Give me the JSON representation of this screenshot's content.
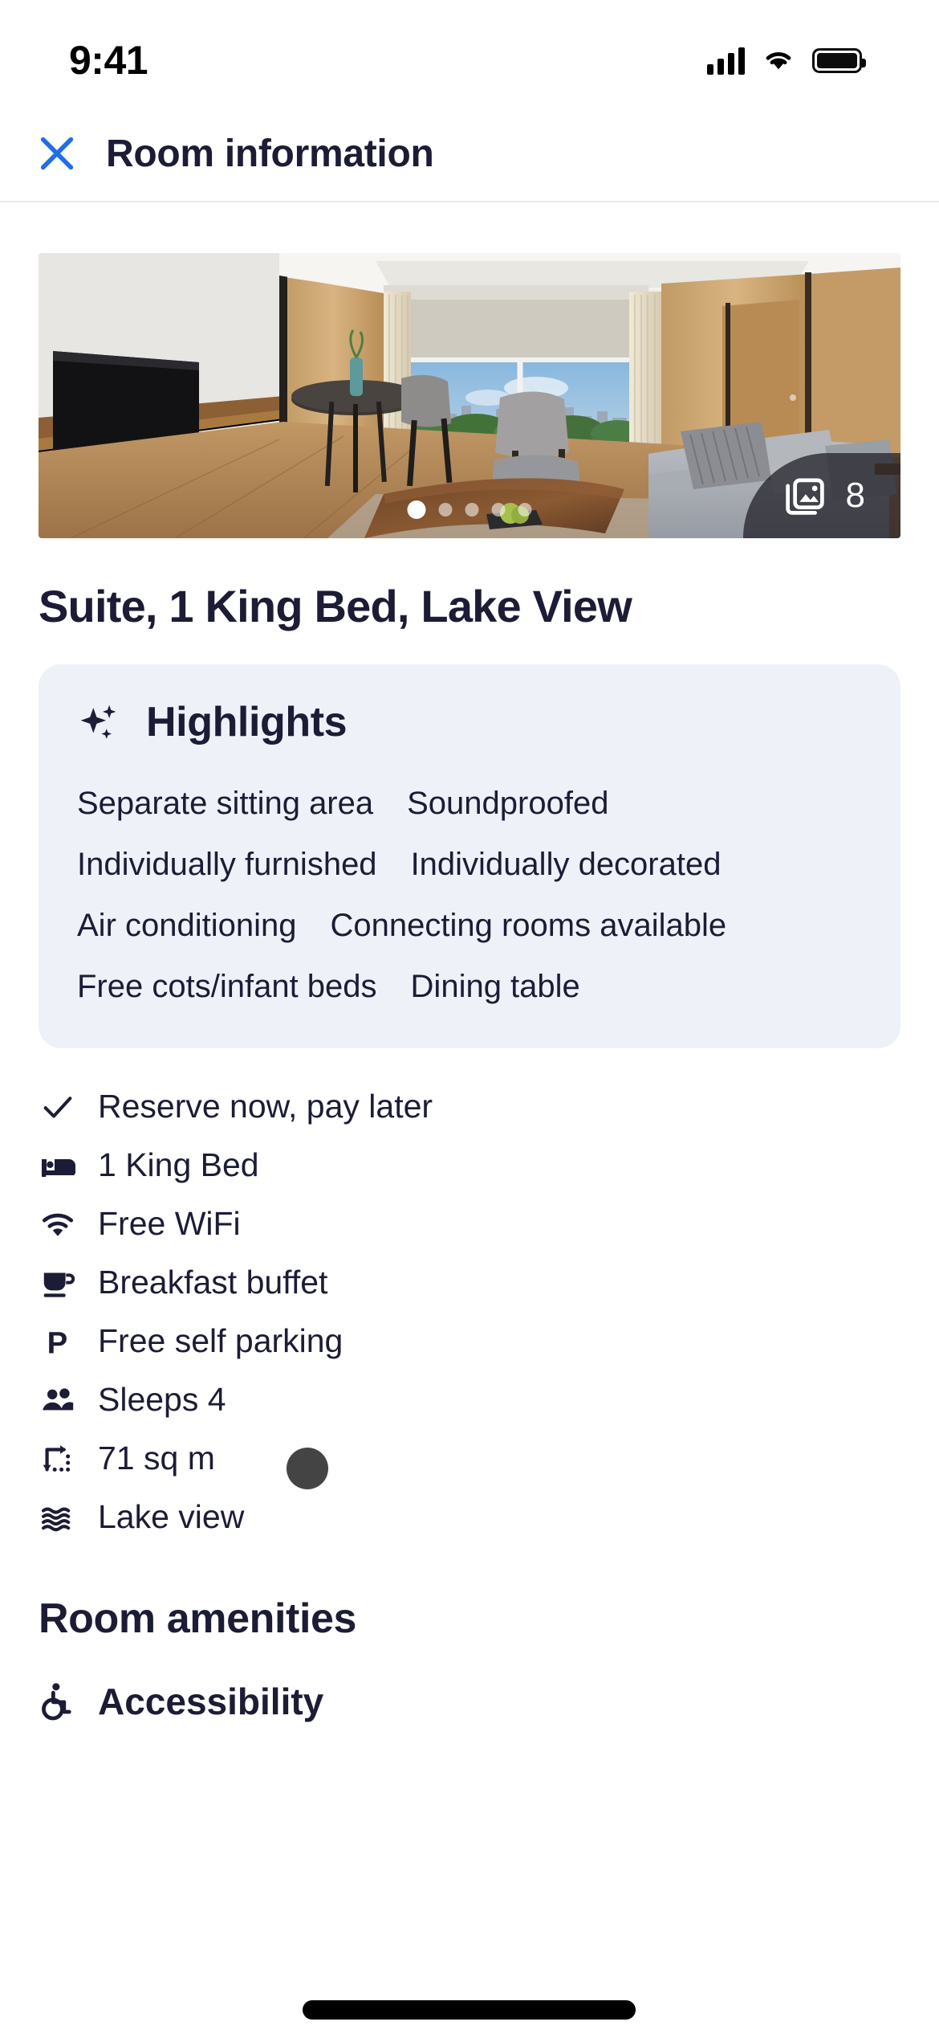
{
  "status_bar": {
    "time": "9:41",
    "signal_icon": "cellular-signal-icon",
    "wifi_icon": "wifi-icon",
    "battery_icon": "battery-full-icon"
  },
  "header": {
    "close_icon": "close-x-icon",
    "title": "Room information",
    "close_color": "#1f6fe5",
    "title_color": "#1c1c36"
  },
  "gallery": {
    "photo_count": "8",
    "photo_stack_icon": "photo-stack-icon",
    "total_dots": 5,
    "active_dot_index": 0,
    "alt": "Hotel suite with sitting area, dining table, sofa and lake view window"
  },
  "room": {
    "title": "Suite, 1 King Bed, Lake View"
  },
  "highlights": {
    "icon": "sparkle-icon",
    "title": "Highlights",
    "background": "#eef1f7",
    "tags": [
      "Separate sitting area",
      "Soundproofed",
      "Individually furnished",
      "Individually decorated",
      "Air conditioning",
      "Connecting rooms available",
      "Free cots/infant beds",
      "Dining table"
    ]
  },
  "amenities": [
    {
      "icon": "check-icon",
      "label": "Reserve now, pay later"
    },
    {
      "icon": "bed-icon",
      "label": "1 King Bed"
    },
    {
      "icon": "wifi-icon",
      "label": "Free WiFi"
    },
    {
      "icon": "coffee-cup-icon",
      "label": "Breakfast buffet"
    },
    {
      "icon": "parking-icon",
      "label": "Free self parking"
    },
    {
      "icon": "people-icon",
      "label": "Sleeps 4"
    },
    {
      "icon": "area-size-icon",
      "label": "71 sq m"
    },
    {
      "icon": "waves-icon",
      "label": "Lake view"
    }
  ],
  "room_amenities": {
    "title": "Room amenities",
    "items": [
      {
        "icon": "accessibility-icon",
        "label": "Accessibility"
      }
    ]
  },
  "overlay": {
    "touch_indicator_color": "#444444",
    "home_indicator_color": "#000000"
  }
}
